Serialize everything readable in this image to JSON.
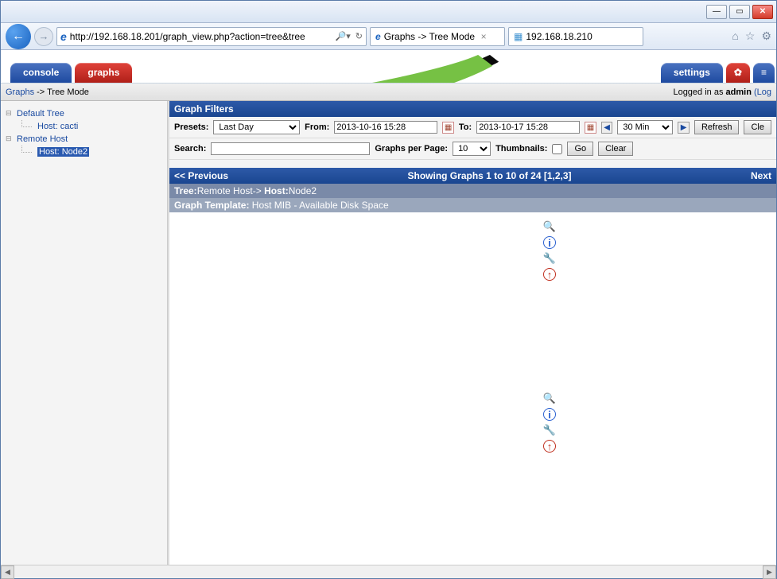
{
  "window": {
    "url": "http://192.168.18.201/graph_view.php?action=tree&tree",
    "tab1_title": "Graphs -> Tree Mode",
    "tab2_title": "192.168.18.210"
  },
  "header_tabs": {
    "console": "console",
    "graphs": "graphs",
    "settings": "settings"
  },
  "breadcrumb": {
    "root": "Graphs",
    "sep": " -> ",
    "current": "Tree Mode",
    "logged_in_prefix": "Logged in as ",
    "user": "admin",
    "logout_paren": " (Log"
  },
  "tree": {
    "default_tree": "Default Tree",
    "host_cacti": "Host: cacti",
    "remote_host": "Remote Host",
    "host_node2": "Host: Node2"
  },
  "filters": {
    "title": "Graph Filters",
    "presets_label": "Presets:",
    "presets_value": "Last Day",
    "from_label": "From:",
    "from_value": "2013-10-16 15:28",
    "to_label": "To:",
    "to_value": "2013-10-17 15:28",
    "span_value": "30 Min",
    "refresh_btn": "Refresh",
    "clear_btn1": "Cle",
    "search_label": "Search:",
    "search_value": "",
    "gpp_label": "Graphs per Page:",
    "gpp_value": "10",
    "thumbnails_label": "Thumbnails:",
    "go_btn": "Go",
    "clear_btn2": "Clear"
  },
  "pager": {
    "prev": "<< Previous",
    "showing": "Showing Graphs 1 to 10 of 24 [1,2,3]",
    "next": "Next"
  },
  "context": {
    "tree_label": "Tree:",
    "tree_value": "Remote Host-> ",
    "host_label": "Host:",
    "host_value": "Node2",
    "template_label": "Graph Template: ",
    "template_value": "Host MIB - Available Disk Space"
  }
}
